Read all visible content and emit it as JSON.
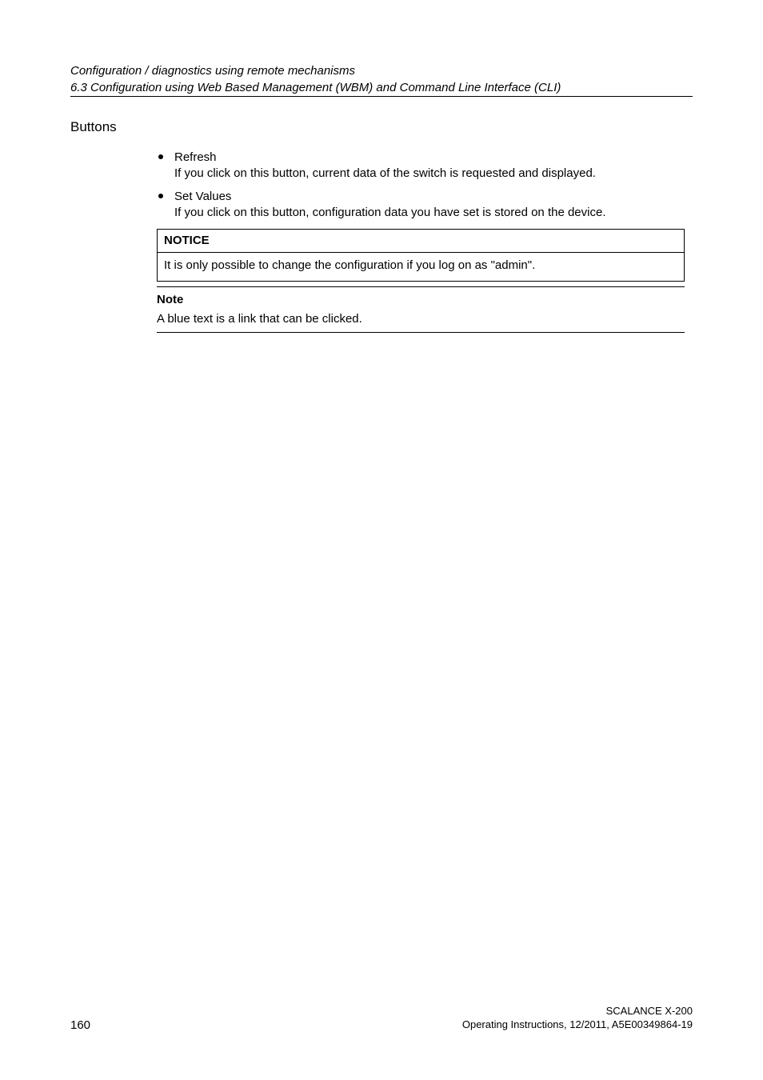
{
  "header": {
    "line1": "Configuration / diagnostics using remote mechanisms",
    "line2": "6.3 Configuration using Web Based Management (WBM) and Command Line Interface (CLI)"
  },
  "section": {
    "title": "Buttons",
    "bullets": [
      {
        "label": "Refresh",
        "desc": "If you click on this button, current data of the switch is requested and displayed."
      },
      {
        "label": "Set Values",
        "desc": "If you click on this button, configuration data you have set is stored on the device."
      }
    ],
    "notice": {
      "heading": "NOTICE",
      "body": "It is only possible to change the configuration if you log on as \"admin\"."
    },
    "note": {
      "label": "Note",
      "text": "A blue text is a link that can be clicked."
    }
  },
  "footer": {
    "page": "160",
    "right1": "SCALANCE X-200",
    "right2": "Operating Instructions, 12/2011, A5E00349864-19"
  }
}
